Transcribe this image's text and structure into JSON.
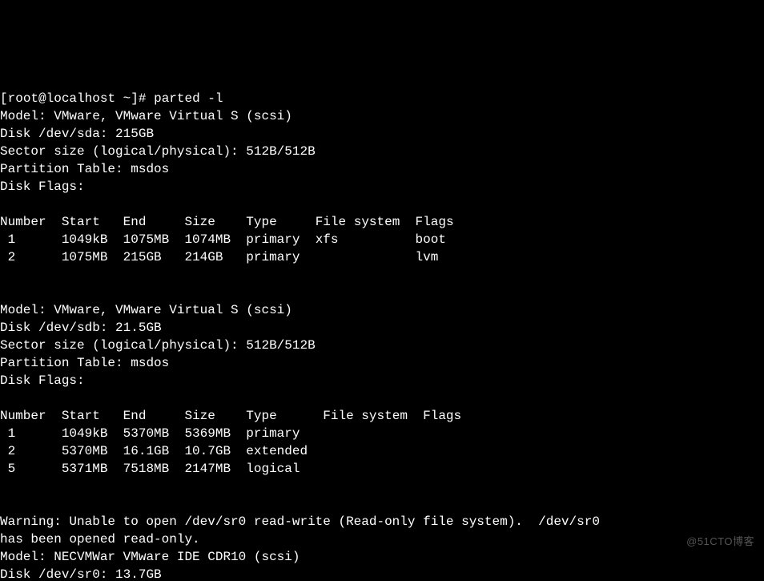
{
  "prompt": {
    "user": "root",
    "host": "localhost",
    "cwd": "~",
    "symbol": "#",
    "command": "parted -l"
  },
  "disks": [
    {
      "model": "VMware, VMware Virtual S (scsi)",
      "path": "/dev/sda",
      "size": "215GB",
      "sector_size": "512B/512B",
      "partition_table": "msdos",
      "disk_flags": "",
      "headers": [
        "Number",
        "Start",
        "End",
        "Size",
        "Type",
        "File system",
        "Flags"
      ],
      "partitions": [
        {
          "number": "1",
          "start": "1049kB",
          "end": "1075MB",
          "size": "1074MB",
          "type": "primary",
          "fs": "xfs",
          "flags": "boot"
        },
        {
          "number": "2",
          "start": "1075MB",
          "end": "215GB",
          "size": "214GB",
          "type": "primary",
          "fs": "",
          "flags": "lvm"
        }
      ]
    },
    {
      "model": "VMware, VMware Virtual S (scsi)",
      "path": "/dev/sdb",
      "size": "21.5GB",
      "sector_size": "512B/512B",
      "partition_table": "msdos",
      "disk_flags": "",
      "headers": [
        "Number",
        "Start",
        "End",
        "Size",
        "Type",
        "File system",
        "Flags"
      ],
      "partitions": [
        {
          "number": "1",
          "start": "1049kB",
          "end": "5370MB",
          "size": "5369MB",
          "type": "primary",
          "fs": "",
          "flags": ""
        },
        {
          "number": "2",
          "start": "5370MB",
          "end": "16.1GB",
          "size": "10.7GB",
          "type": "extended",
          "fs": "",
          "flags": ""
        },
        {
          "number": "5",
          "start": "5371MB",
          "end": "7518MB",
          "size": "2147MB",
          "type": "logical",
          "fs": "",
          "flags": ""
        }
      ]
    }
  ],
  "warning": "Warning: Unable to open /dev/sr0 read-write (Read-only file system).  /dev/sr0\nhas been opened read-only.",
  "sr0": {
    "model": "NECVMWar VMware IDE CDR10 (scsi)",
    "path": "/dev/sr0",
    "size": "13.7GB"
  },
  "labels": {
    "model": "Model:",
    "disk": "Disk",
    "sector": "Sector size (logical/physical):",
    "ptable": "Partition Table:",
    "dflags": "Disk Flags:"
  },
  "watermark": "@51CTO博客"
}
